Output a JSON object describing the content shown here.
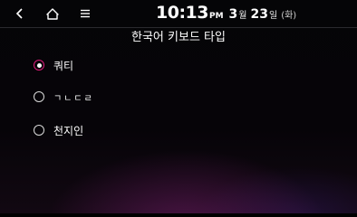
{
  "status": {
    "time": "10:13",
    "ampm": "PM",
    "month": "3",
    "month_unit": "월",
    "day": "23",
    "day_unit": "일",
    "weekday": "(화)"
  },
  "nav": {
    "back_icon": "chevron-left-icon",
    "home_icon": "home-icon",
    "menu_icon": "menu-icon"
  },
  "page": {
    "title": "한국어 키보드 타입"
  },
  "options": [
    {
      "label": "쿼티",
      "selected": true
    },
    {
      "label": "ㄱㄴㄷㄹ",
      "selected": false
    },
    {
      "label": "천지인",
      "selected": false
    }
  ],
  "colors": {
    "accent": "#d91a78",
    "background": "#050507"
  }
}
